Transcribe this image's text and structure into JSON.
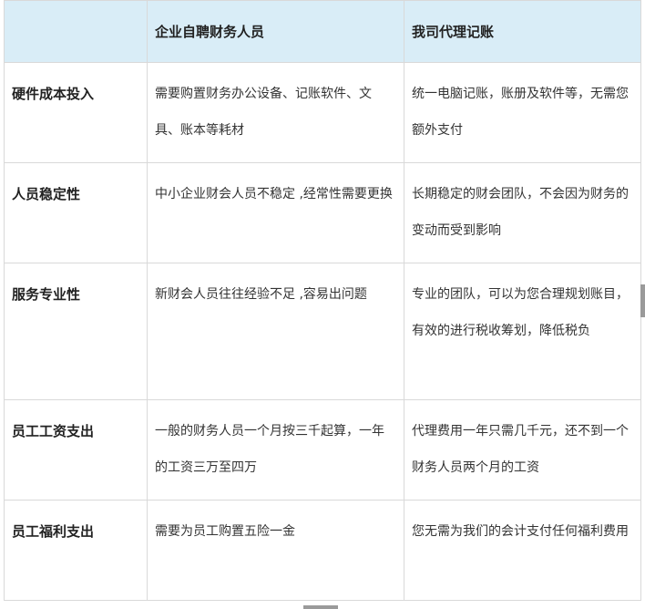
{
  "table": {
    "headers": [
      "",
      "企业自聘财务人员",
      "我司代理记账"
    ],
    "rows": [
      {
        "label": "硬件成本投入",
        "inhouse": "需要购置财务办公设备、记账软件、文具、账本等耗材",
        "agency": "统一电脑记账，账册及软件等，无需您额外支付"
      },
      {
        "label": "人员稳定性",
        "inhouse": "中小企业财会人员不稳定 ,经常性需要更换",
        "agency": "长期稳定的财会团队，不会因为财务的变动而受到影响"
      },
      {
        "label": "服务专业性",
        "inhouse": "新财会人员往往经验不足 ,容易出问题",
        "agency": "专业的团队，可以为您合理规划账目，有效的进行税收筹划，降低税负"
      },
      {
        "label": "员工工资支出",
        "inhouse": "一般的财务人员一个月按三千起算，一年的工资三万至四万",
        "agency": "代理费用一年只需几千元，还不到一个财务人员两个月的工资"
      },
      {
        "label": "员工福利支出",
        "inhouse": "需要为员工购置五险一金",
        "agency": "您无需为我们的会计支付任何福利费用"
      }
    ]
  },
  "colors": {
    "header_bg": "#d9edf7",
    "border": "#d9d9d9"
  }
}
